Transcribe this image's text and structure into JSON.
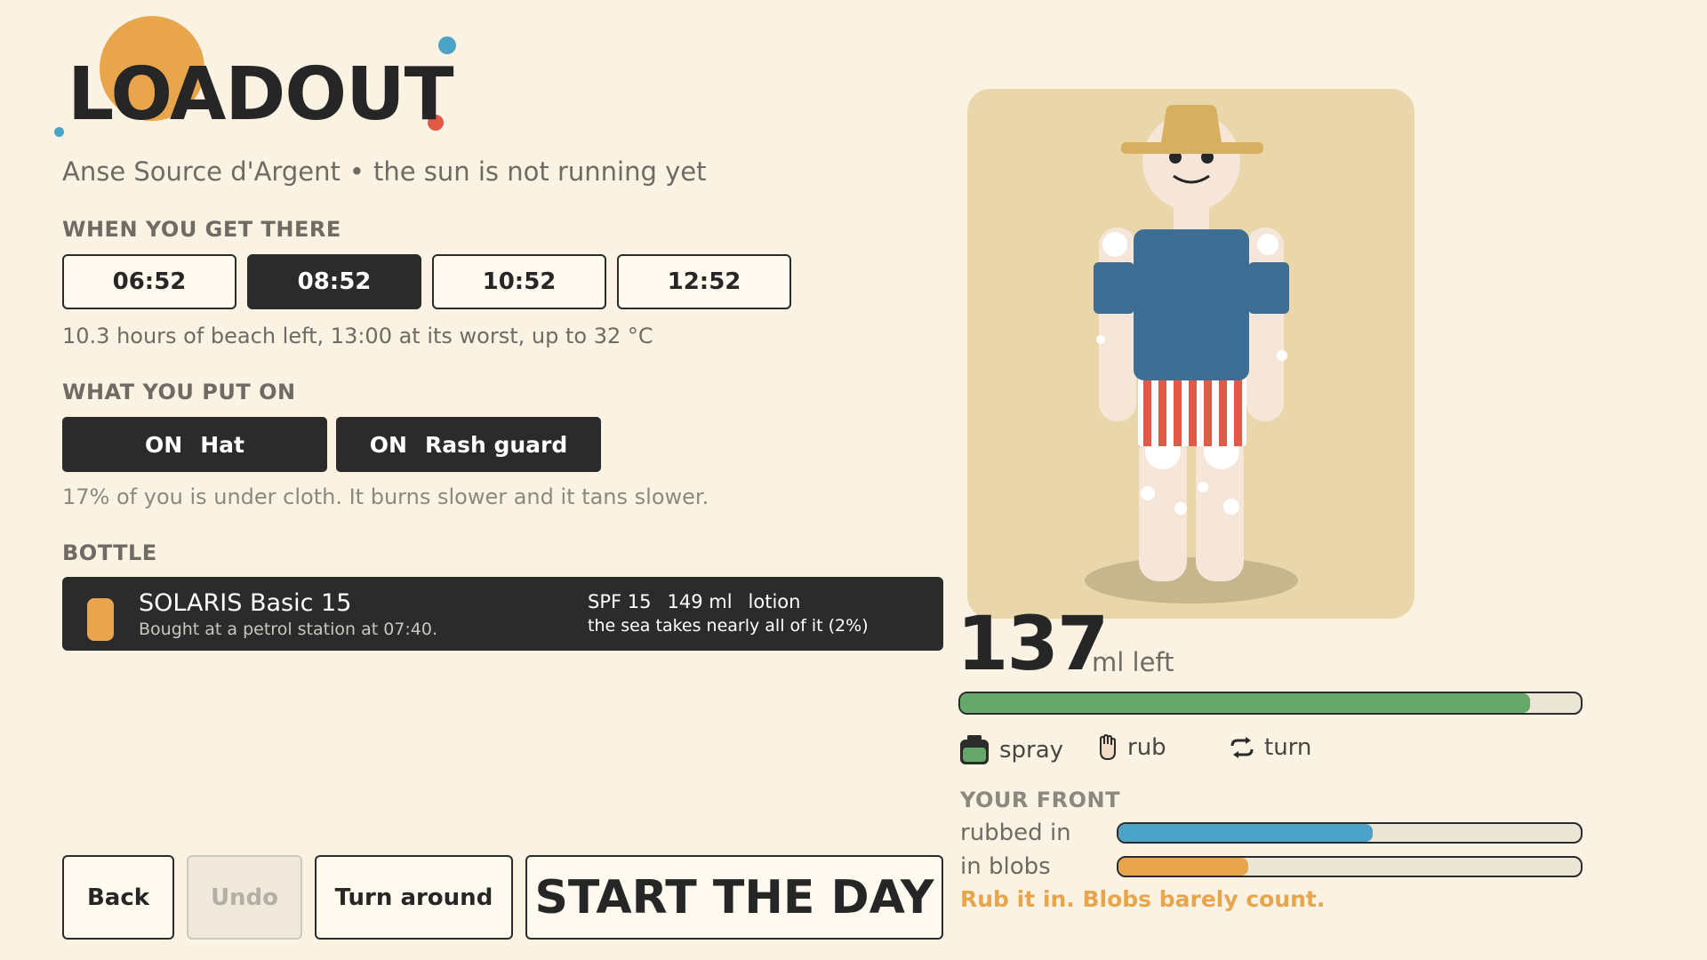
{
  "title": "LOADOUT",
  "subtitle": {
    "location": "Anse Source d'Argent",
    "separator": "•",
    "status": "the sun is not running yet"
  },
  "arrival": {
    "heading": "WHEN YOU GET THERE",
    "times": [
      "06:52",
      "08:52",
      "10:52",
      "12:52"
    ],
    "selected": "08:52",
    "info": "10.3 hours of beach left, 13:00 at its worst, up to 32 °C"
  },
  "clothing": {
    "heading": "WHAT YOU PUT ON",
    "items": [
      {
        "state": "ON",
        "label": "Hat"
      },
      {
        "state": "ON",
        "label": "Rash guard"
      }
    ],
    "info": "17% of you is under cloth. It burns slower and it tans slower."
  },
  "bottle": {
    "heading": "BOTTLE",
    "name": "SOLARIS Basic 15",
    "origin": "Bought at a petrol station at 07:40.",
    "spf": "SPF 15",
    "volume": "149 ml",
    "kind": "lotion",
    "note": "the sea takes nearly all of it (2%)"
  },
  "actions": {
    "back": "Back",
    "undo": "Undo",
    "turn": "Turn around",
    "start": "START THE DAY"
  },
  "sunscreen": {
    "ml_left": "137",
    "unit": "ml left",
    "fraction": 0.919
  },
  "tools": {
    "spray": "spray",
    "rub": "rub",
    "turn": "turn"
  },
  "front": {
    "heading": "YOUR FRONT",
    "rubbed_label": "rubbed in",
    "rubbed_fraction": 0.55,
    "blobs_label": "in blobs",
    "blobs_fraction": 0.28,
    "hint": "Rub it in. Blobs barely count."
  },
  "colors": {
    "dark": "#2b2b2b",
    "background": "#faf3e3",
    "green": "#66a86a",
    "blue": "#4ba3c7",
    "orange": "#e8a54b",
    "red": "#e05a45",
    "shirt": "#3e6e93"
  }
}
